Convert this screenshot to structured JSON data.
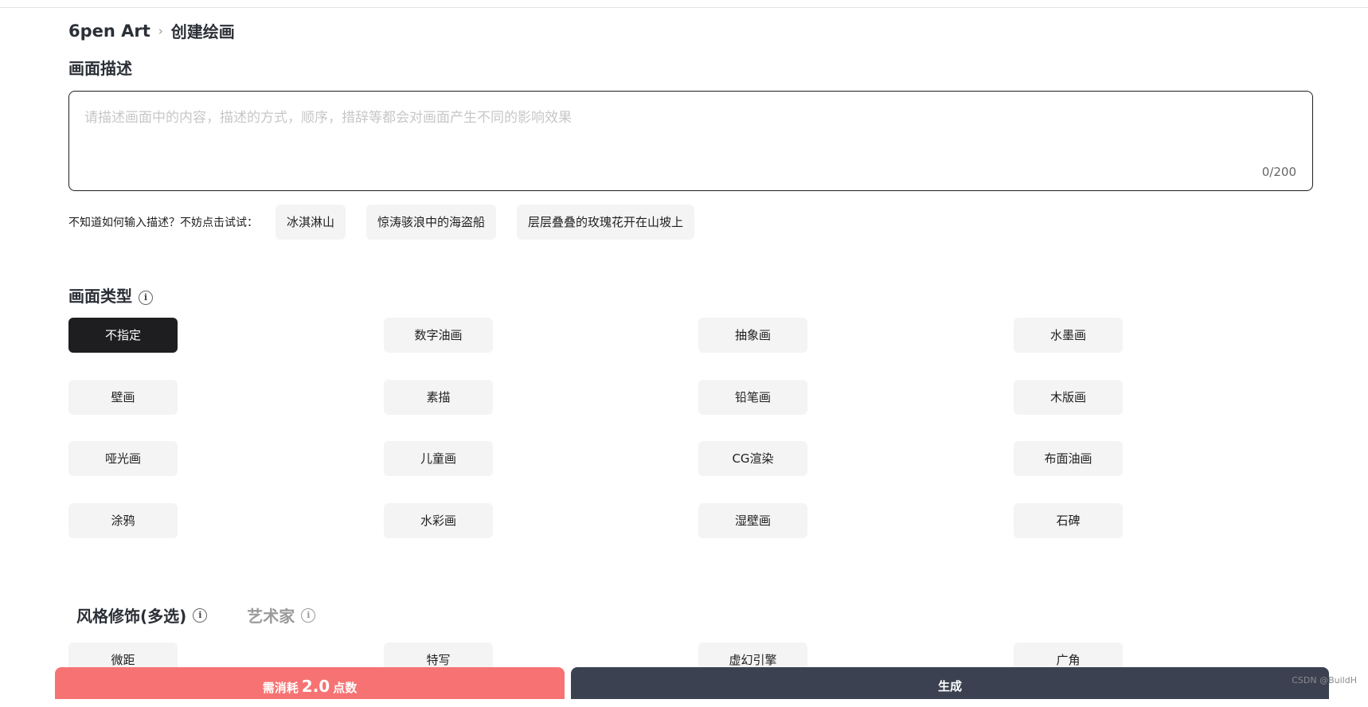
{
  "breadcrumb": {
    "home": "6pen Art",
    "separator": "›",
    "current": "创建绘画"
  },
  "description": {
    "title": "画面描述",
    "placeholder": "请描述画面中的内容，描述的方式，顺序，措辞等都会对画面产生不同的影响效果",
    "value": "",
    "counter": "0/200"
  },
  "hints": {
    "label": "不知道如何输入描述？不妨点击试试：",
    "items": [
      "冰淇淋山",
      "惊涛骇浪中的海盗船",
      "层层叠叠的玫瑰花开在山坡上"
    ]
  },
  "picture_type": {
    "title": "画面类型",
    "info_icon": "i",
    "selected": "不指定",
    "options": [
      "不指定",
      "数字油画",
      "抽象画",
      "水墨画",
      "壁画",
      "素描",
      "铅笔画",
      "木版画",
      "哑光画",
      "儿童画",
      "CG渲染",
      "布面油画",
      "涂鸦",
      "水彩画",
      "湿壁画",
      "石碑"
    ]
  },
  "style_tabs": {
    "active": "风格修饰(多选)",
    "inactive": "艺术家",
    "info_icon": "i"
  },
  "style_options": [
    "微距",
    "特写",
    "虚幻引擎",
    "广角"
  ],
  "footer": {
    "cost_prefix": "需消耗",
    "cost_value": "2.0",
    "cost_suffix": "点数",
    "generate": "生成"
  },
  "watermark": "CSDN @BuildH",
  "colors": {
    "selected_bg": "#1e1e21",
    "chip_bg": "#f4f4f5",
    "cost_bar": "#f77373",
    "generate_bar": "#3b4150"
  }
}
